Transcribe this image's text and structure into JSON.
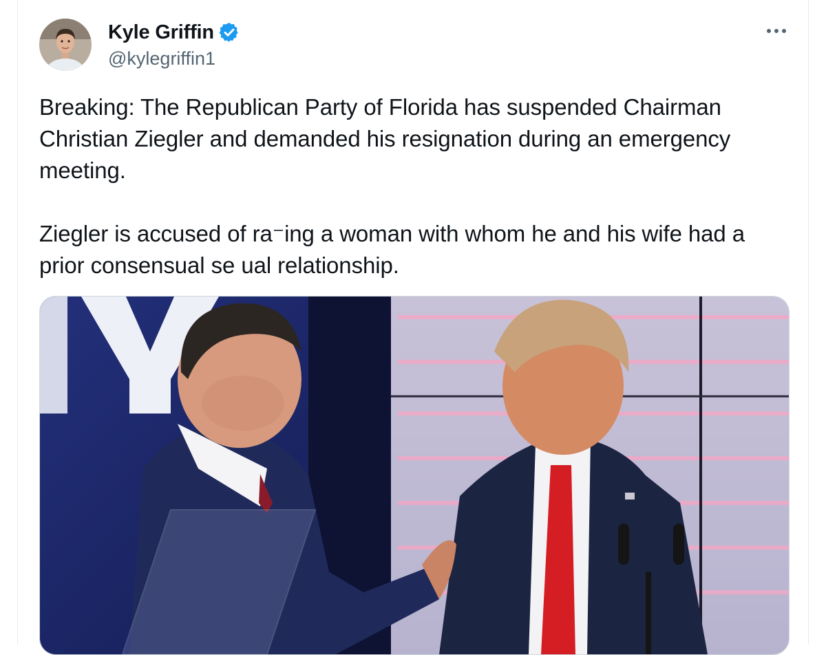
{
  "author": {
    "name": "Kyle Griffin",
    "handle": "@kylegriffin1",
    "verified": true
  },
  "tweet": {
    "paragraph1": "Breaking: The Republican Party of Florida has suspended Chairman Christian Ziegler and demanded his resignation during an emergency meeting.",
    "paragraph2": "Ziegler is accused of ra⁻ing a woman with whom he and his wife had a prior consensual se ual relationship."
  },
  "icons": {
    "verified": "verified-badge-icon",
    "more": "more-options-icon"
  },
  "colors": {
    "verified_blue": "#1d9bf0",
    "text": "#0f1419",
    "secondary_text": "#536471"
  }
}
